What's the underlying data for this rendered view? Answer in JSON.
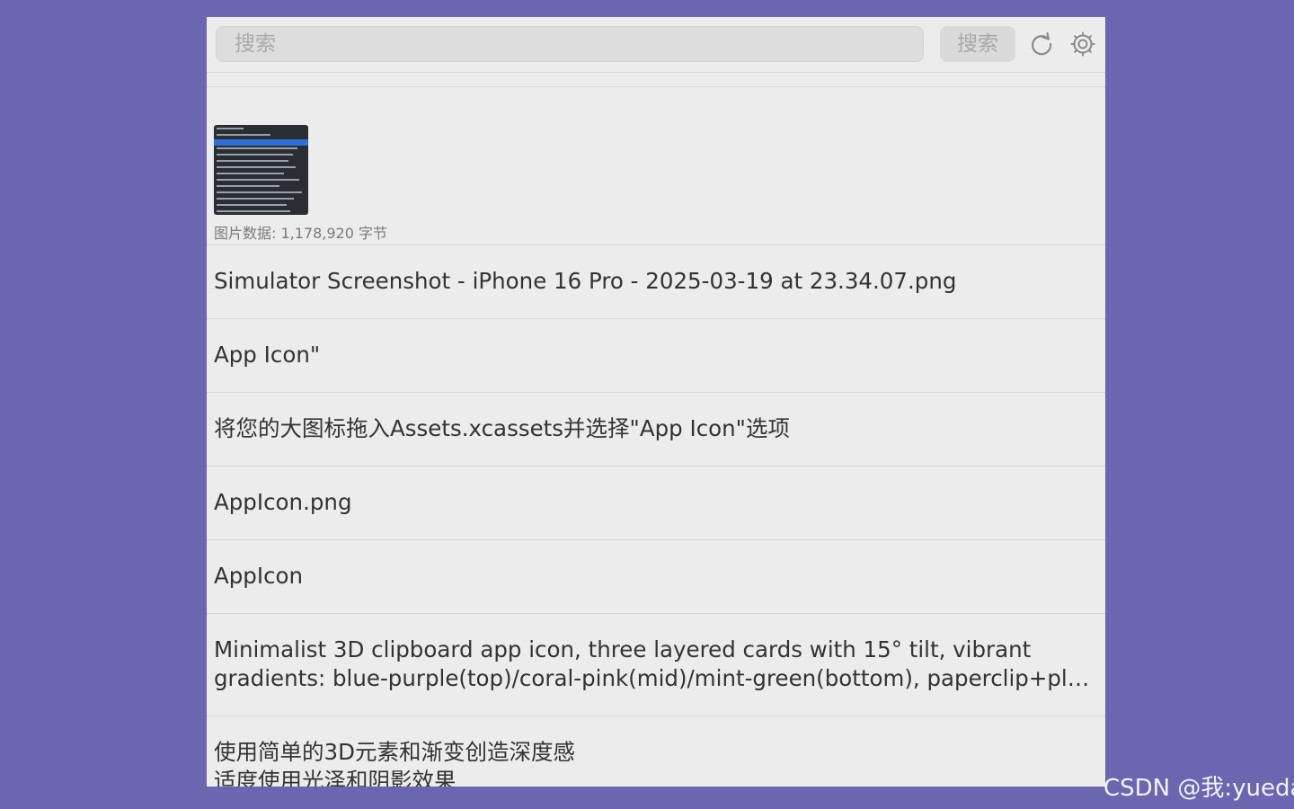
{
  "toolbar": {
    "search_placeholder": "搜索",
    "search_button_label": "搜索",
    "refresh_icon": "refresh-icon",
    "settings_icon": "gear-icon"
  },
  "clips": [
    {
      "type": "image",
      "meta": "图片数据: 1,178,920 字节"
    },
    {
      "type": "text",
      "text": "Simulator Screenshot - iPhone 16 Pro - 2025-03-19 at 23.34.07.png"
    },
    {
      "type": "text",
      "text": "App Icon\""
    },
    {
      "type": "text",
      "text": "将您的大图标拖入Assets.xcassets并选择\"App Icon\"选项"
    },
    {
      "type": "text",
      "text": "AppIcon.png"
    },
    {
      "type": "text",
      "text": "AppIcon"
    },
    {
      "type": "text",
      "lines": [
        "Minimalist 3D clipboard app icon, three layered cards with 15° tilt, vibrant",
        "gradients: blue-purple(top)/coral-pink(mid)/mint-green(bottom), paperclip+plu..."
      ]
    },
    {
      "type": "text",
      "lines": [
        "使用简单的3D元素和渐变创造深度感",
        "适度使用光泽和阴影效果"
      ]
    }
  ],
  "watermark": "CSDN @我:yueda",
  "colors": {
    "background": "#6a66b0",
    "panel": "#ececec",
    "divider": "#d6d6d6"
  }
}
